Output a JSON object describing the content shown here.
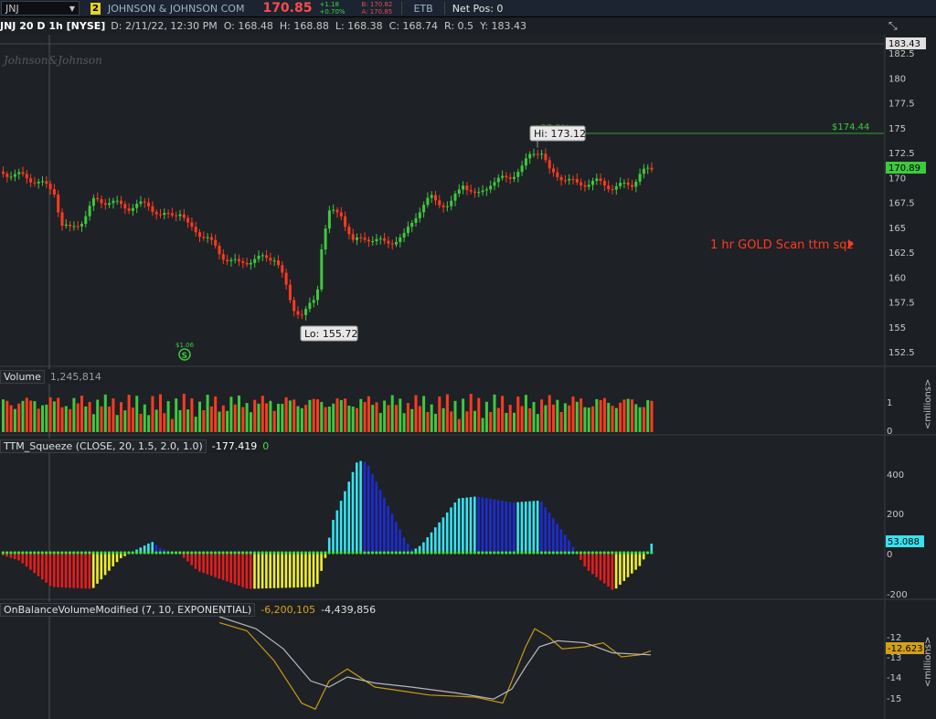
{
  "topbar": {
    "symbol": "JNJ",
    "link_badge": "2",
    "company": "JOHNSON & JOHNSON COM",
    "last_price": "170.85",
    "change": "+1.18",
    "change_pct": "+0.70%",
    "bid": "B: 170.82",
    "ask": "A: 170.85",
    "etb": "ETB",
    "net_pos": "Net Pos: 0"
  },
  "infobar": {
    "title": "JNJ 20 D 1h [NYSE]",
    "date": "D: 2/11/22, 12:30 PM",
    "open": "O: 168.48",
    "high": "H: 168.88",
    "low": "L: 168.38",
    "close": "C: 168.74",
    "range": "R: 0.5",
    "y": "Y: 183.43"
  },
  "price_panel": {
    "watermark": "Johnson&Johnson",
    "ticks": [
      "182.5",
      "180",
      "177.5",
      "175",
      "172.5",
      "170",
      "167.5",
      "165",
      "162.5",
      "160",
      "157.5",
      "155",
      "152.5"
    ],
    "cursor_price": "183.43",
    "last_price_tag": "170.89",
    "hi_label": "Hi: 173.12",
    "lo_label": "Lo: 155.72",
    "hidden_pct": "+27.2%",
    "target_price": "$174.44",
    "scan_label": "1 hr GOLD Scan ttm sqz",
    "dividend_label": "$1.06",
    "dividend_icon": "S",
    "colors": {
      "up": "#3ec93e",
      "down": "#ff3b1f",
      "scan": "#ff3b1f",
      "target": "#3ec93e"
    }
  },
  "volume_panel": {
    "name": "Volume",
    "value": "1,245,814",
    "tick": "1",
    "zero": "0",
    "unit": "<millions>"
  },
  "squeeze_panel": {
    "name": "TTM_Squeeze (CLOSE, 20, 1.5, 2.0, 1.0)",
    "value": "-177.419",
    "value2": "0",
    "ticks": [
      "400",
      "200",
      "0",
      "-200"
    ],
    "last_tag": "53.088",
    "colors": {
      "cyan": "#36e3f0",
      "blue": "#1c2bd8",
      "red": "#e81c1c",
      "yellow": "#f2ef2a",
      "dot": "#3ee03e"
    }
  },
  "obv_panel": {
    "name": "OnBalanceVolumeModified (7, 10, EXPONENTIAL)",
    "value1": "-6,200,105",
    "value2": "-4,439,856",
    "ticks": [
      "-12",
      "-13",
      "-14",
      "-15"
    ],
    "last_tag": "-12.623",
    "unit": "<millions>"
  }
}
